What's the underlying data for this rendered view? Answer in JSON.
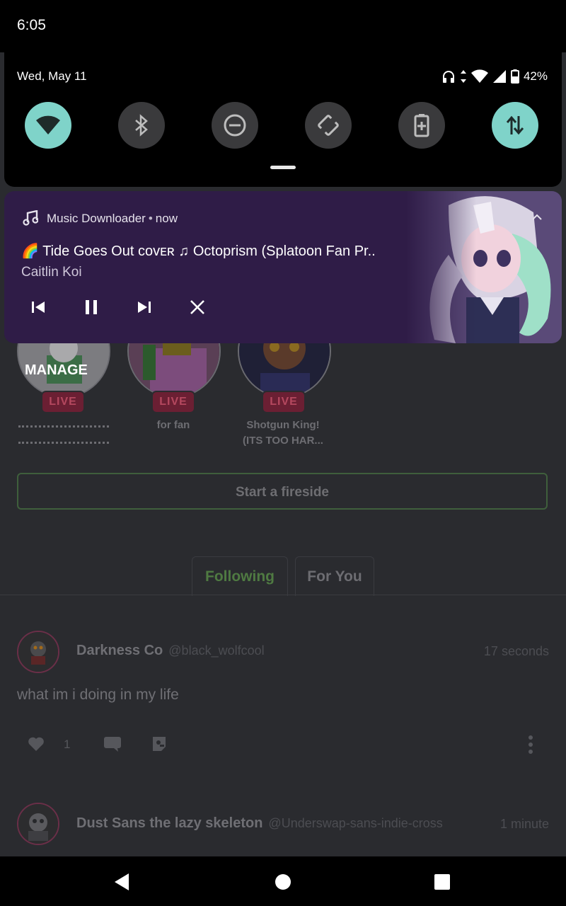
{
  "status_bar": {
    "time": "6:05",
    "date": "Wed, May 11",
    "battery": "42%",
    "icons": [
      "headphones-icon",
      "data-arrows-icon",
      "wifi-icon",
      "signal-icon",
      "battery-icon"
    ]
  },
  "quick_settings": {
    "tiles": [
      {
        "name": "wifi",
        "icon": "wifi-icon",
        "active": true
      },
      {
        "name": "bluetooth",
        "icon": "bluetooth-icon",
        "active": false
      },
      {
        "name": "do-not-disturb",
        "icon": "dnd-icon",
        "active": false
      },
      {
        "name": "auto-rotate",
        "icon": "rotate-icon",
        "active": false
      },
      {
        "name": "battery-saver",
        "icon": "battery-saver-icon",
        "active": false
      },
      {
        "name": "mobile-data",
        "icon": "mobile-data-icon",
        "active": true
      }
    ],
    "accent_color": "#7fd3c9"
  },
  "notification": {
    "app_name": "Music Downloader",
    "separator": "•",
    "time": "now",
    "title": "🌈 Tide Goes Out ᴄᴏᴠᴇʀ ♫ Octoprism (Splatoon Fan Pr..",
    "artist": "Caitlin Koi",
    "controls": [
      "previous-icon",
      "pause-icon",
      "next-icon",
      "close-icon"
    ],
    "background_color": "#2f1c47"
  },
  "live_row": {
    "manage_label": "MANAGE",
    "items": [
      {
        "badge": "LIVE",
        "caption": ""
      },
      {
        "badge": "LIVE",
        "caption": "for fan"
      },
      {
        "badge": "LIVE",
        "caption_line1": "Shotgun King!",
        "caption_line2": "(ITS TOO HAR..."
      }
    ]
  },
  "fireside_button": "Start a fireside",
  "tabs": [
    {
      "label": "Following",
      "active": true
    },
    {
      "label": "For You",
      "active": false
    }
  ],
  "posts": [
    {
      "name": "Darkness Co",
      "handle": "@black_wolfcool",
      "time": "17 seconds",
      "text": "what im i doing in my life",
      "likes": "1"
    },
    {
      "name": "Dust Sans the lazy skeleton",
      "handle": "@Underswap-sans-indie-cross",
      "time": "1 minute"
    }
  ]
}
